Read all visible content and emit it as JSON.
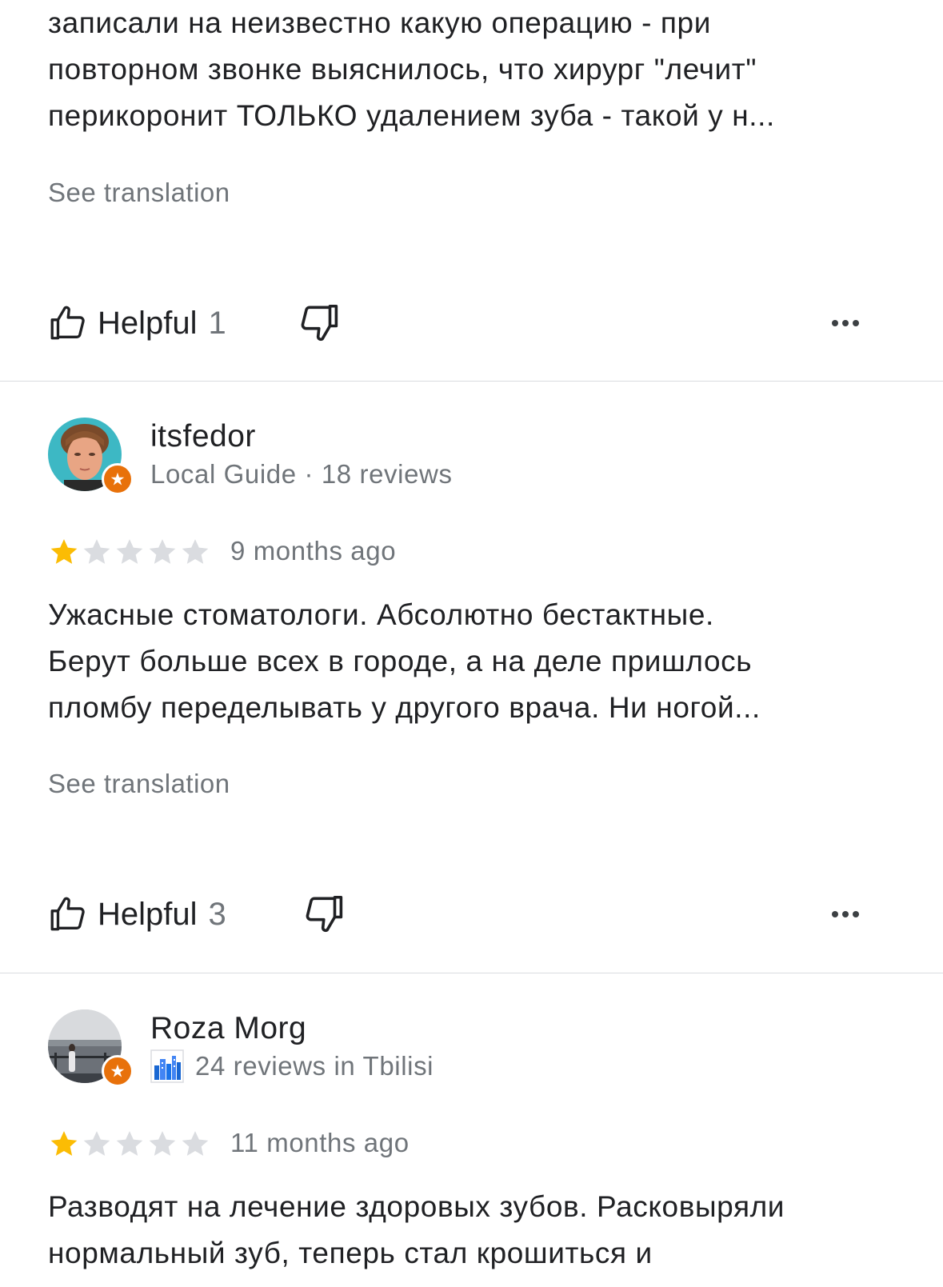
{
  "reviews": [
    {
      "text": "записали на неизвестно какую операцию - при\nповторном звонке выяснилось, что хирург \"лечит\"\nперикоронит ТОЛЬКО удалением зуба - такой у н...",
      "see_translation": "See translation",
      "helpful_label": "Helpful",
      "helpful_count": "1"
    },
    {
      "reviewer_name": "itsfedor",
      "reviewer_meta": "Local Guide · 18 reviews",
      "rating": 1,
      "max_rating": 5,
      "date": "9 months ago",
      "text": "Ужасные стоматологи. Абсолютно бестактные.\nБерут больше всех в городе, а на деле пришлось\nпломбу переделывать у другого врача. Ни ногой...",
      "see_translation": "See translation",
      "helpful_label": "Helpful",
      "helpful_count": "3"
    },
    {
      "reviewer_name": "Roza Morg",
      "reviewer_meta": "24 reviews in Tbilisi",
      "rating": 1,
      "max_rating": 5,
      "date": "11 months ago",
      "text": "Разводят на лечение здоровых зубов. Расковыряли\nнормальный зуб, теперь стал крошиться и"
    }
  ],
  "colors": {
    "star_filled": "#fbbc04",
    "star_empty": "#dadce0",
    "badge": "#e8710a",
    "secondary_text": "#70757a",
    "primary_text": "#202124"
  },
  "icons": {
    "helpful": "thumbs-up-icon",
    "not_helpful": "thumbs-down-icon",
    "more": "more-horizontal-icon",
    "local_guide_badge": "local-guide-star-icon",
    "city_expert": "city-skyline-icon"
  }
}
